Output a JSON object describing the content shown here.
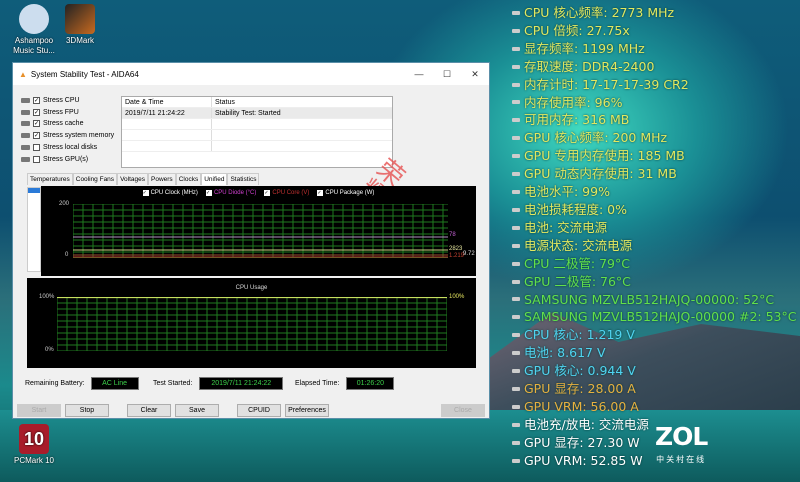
{
  "desktop": {
    "icons": [
      {
        "label": "Ashampoo Music Stu..."
      },
      {
        "label": "3DMark"
      },
      {
        "label": "PCMark 10"
      }
    ]
  },
  "window": {
    "title": "System Stability Test - AIDA64",
    "stress": [
      {
        "label": "Stress CPU",
        "checked": true
      },
      {
        "label": "Stress FPU",
        "checked": true
      },
      {
        "label": "Stress cache",
        "checked": true
      },
      {
        "label": "Stress system memory",
        "checked": true
      },
      {
        "label": "Stress local disks",
        "checked": false
      },
      {
        "label": "Stress GPU(s)",
        "checked": false
      }
    ],
    "log": {
      "headers": [
        "Date & Time",
        "Status"
      ],
      "rows": [
        [
          "2019/7/11 21:24:22",
          "Stability Test: Started"
        ]
      ]
    },
    "tabs": [
      "Temperatures",
      "Cooling Fans",
      "Voltages",
      "Powers",
      "Clocks",
      "Unified",
      "Statistics"
    ],
    "active_tab": "Unified",
    "chart1": {
      "legend": [
        {
          "label": "CPU Clock (MHz)",
          "color": "#ffffff"
        },
        {
          "label": "CPU Diode (°C)",
          "color": "#d040d0"
        },
        {
          "label": "CPU Core (V)",
          "color": "#c03030"
        },
        {
          "label": "CPU Package (W)",
          "color": "#ffffff"
        }
      ],
      "y_max": "200",
      "y_min": "0",
      "values": {
        "diode": "78",
        "clock": "2823",
        "core": "1.219",
        "package": "9.72"
      }
    },
    "chart2": {
      "title": "CPU Usage",
      "y_max": "100%",
      "y_min": "0%",
      "value": "100%"
    },
    "status": {
      "battery_label": "Remaining Battery:",
      "battery": "AC Line",
      "started_label": "Test Started:",
      "started": "2019/7/11 21:24:22",
      "elapsed_label": "Elapsed Time:",
      "elapsed": "01:26:20"
    },
    "buttons": {
      "start": "Start",
      "stop": "Stop",
      "clear": "Clear",
      "save": "Save",
      "cpuid": "CPUID",
      "preferences": "Preferences",
      "close": "Close"
    },
    "stamp": "荣耀"
  },
  "overlay": [
    {
      "text": "CPU 核心频率: 2773 MHz",
      "color": "#e2e860"
    },
    {
      "text": "CPU 倍频: 27.75x",
      "color": "#e2e860"
    },
    {
      "text": "显存频率: 1199 MHz",
      "color": "#e2e860"
    },
    {
      "text": "存取速度: DDR4-2400",
      "color": "#e2e860"
    },
    {
      "text": "内存计时: 17-17-17-39 CR2",
      "color": "#e2e860"
    },
    {
      "text": "内存使用率: 96%",
      "color": "#e2e860"
    },
    {
      "text": "可用内存: 316 MB",
      "color": "#e2e860"
    },
    {
      "text": "GPU 核心频率: 200 MHz",
      "color": "#e2e860"
    },
    {
      "text": "GPU 专用内存使用: 185 MB",
      "color": "#e2e860"
    },
    {
      "text": "GPU 动态内存使用: 31 MB",
      "color": "#e2e860"
    },
    {
      "text": "电池水平: 99%",
      "color": "#e2e860"
    },
    {
      "text": "电池损耗程度: 0%",
      "color": "#e2e860"
    },
    {
      "text": "电池: 交流电源",
      "color": "#e2e860"
    },
    {
      "text": "电源状态: 交流电源",
      "color": "#e2e860"
    },
    {
      "text": "CPU 二极管: 79°C",
      "color": "#62e04a"
    },
    {
      "text": "GPU 二极管: 76°C",
      "color": "#62e04a"
    },
    {
      "text": "SAMSUNG MZVLB512HAJQ-00000: 52°C",
      "color": "#62e04a"
    },
    {
      "text": "SAMSUNG MZVLB512HAJQ-00000 #2: 53°C",
      "color": "#62e04a"
    },
    {
      "text": "CPU 核心: 1.219 V",
      "color": "#50d4f0"
    },
    {
      "text": "电池: 8.617 V",
      "color": "#50d4f0"
    },
    {
      "text": "GPU 核心: 0.944 V",
      "color": "#50d4f0"
    },
    {
      "text": "GPU 显存: 28.00 A",
      "color": "#e8b040"
    },
    {
      "text": "GPU VRM: 56.00 A",
      "color": "#e8b040"
    },
    {
      "text": "电池充/放电: 交流电源",
      "color": "#ffffff"
    },
    {
      "text": "GPU 显存: 27.30 W",
      "color": "#ffffff"
    },
    {
      "text": "GPU VRM: 52.85 W",
      "color": "#ffffff"
    }
  ],
  "watermark": {
    "brand": "ZOL",
    "sub": "中关村在线"
  }
}
